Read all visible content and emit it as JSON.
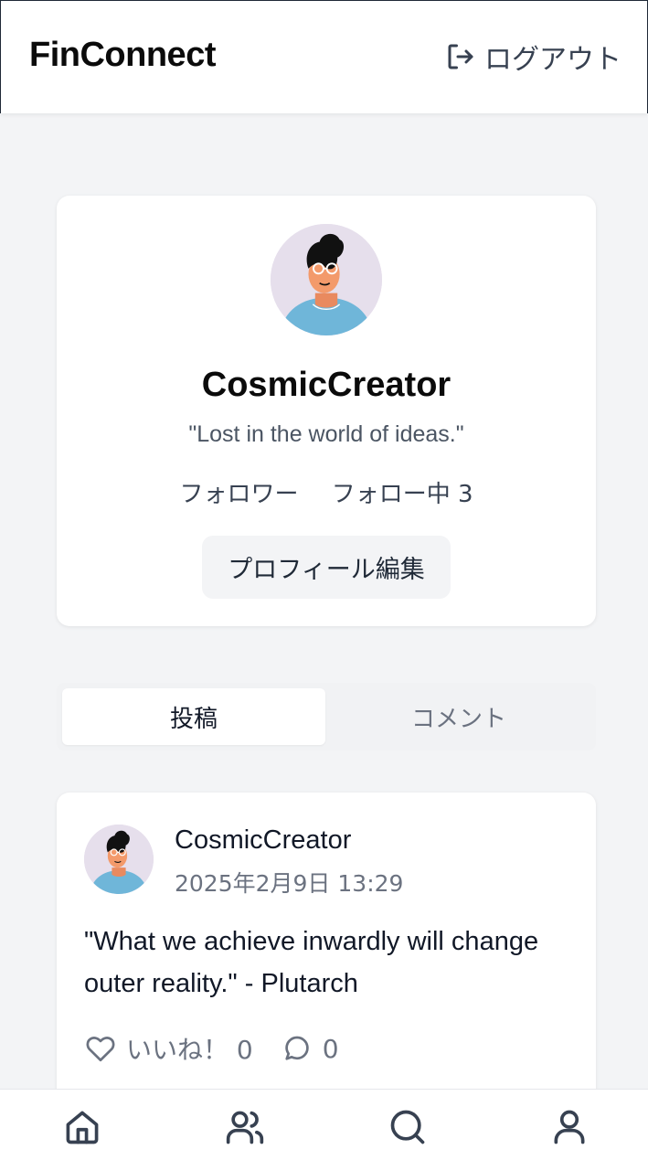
{
  "header": {
    "brand": "FinConnect",
    "logout_label": "ログアウト"
  },
  "profile": {
    "username": "CosmicCreator",
    "bio": "\"Lost in the world of ideas.\"",
    "followers_label": "フォロワー",
    "following_label": "フォロー中 3",
    "edit_label": "プロフィール編集"
  },
  "tabs": [
    {
      "label": "投稿",
      "active": true
    },
    {
      "label": "コメント",
      "active": false
    }
  ],
  "post": {
    "author": "CosmicCreator",
    "date": "2025年2月9日 13:29",
    "body": "\"What we achieve inwardly will change outer reality.\" - Plutarch",
    "like_label": "いいね！ 0",
    "comment_count": "0"
  },
  "nav": [
    "home-icon",
    "users-icon",
    "search-icon",
    "user-icon"
  ],
  "colors": {
    "background": "#f3f4f6",
    "card": "#ffffff",
    "text_primary": "#111827",
    "text_secondary": "#6b7280",
    "avatar_bg": "#e6dfec",
    "avatar_shirt": "#6fb6d9"
  }
}
